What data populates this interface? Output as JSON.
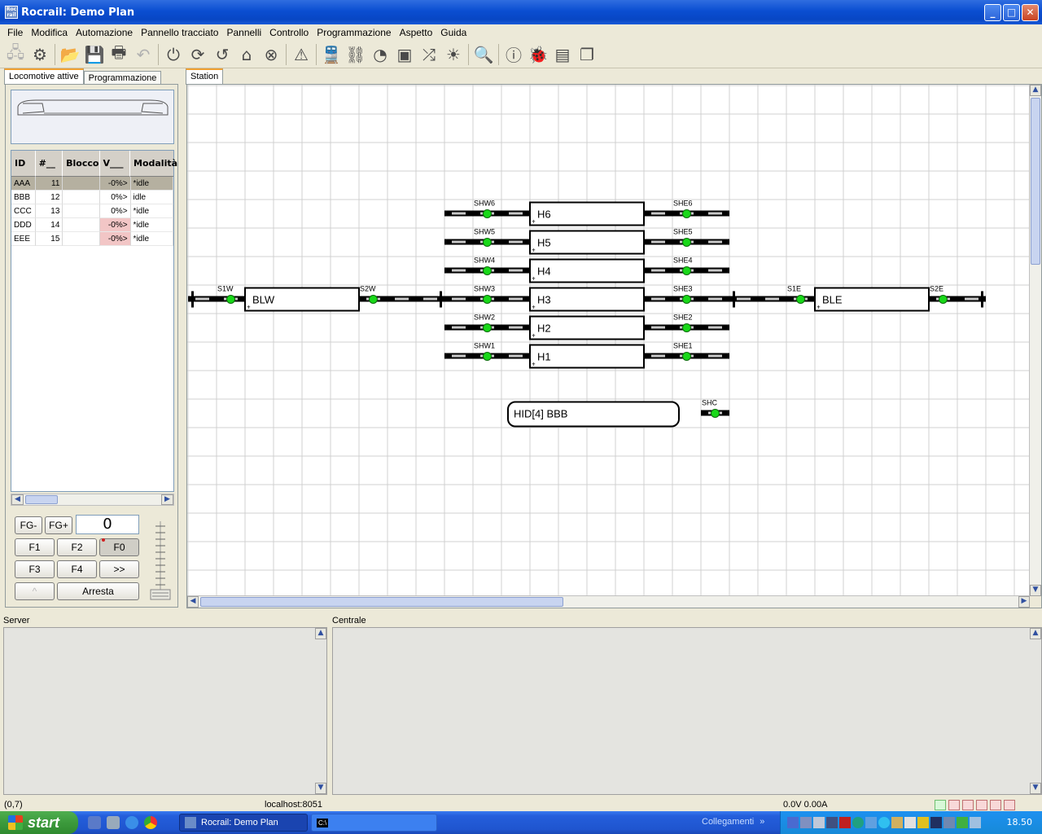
{
  "window": {
    "title": "Rocrail: Demo Plan",
    "app_icon_text": "Roc rail",
    "minimize": "_",
    "maximize": "□",
    "close": "✕"
  },
  "menu": [
    "File",
    "Modifica",
    "Automazione",
    "Pannello tracciato",
    "Pannelli",
    "Controllo",
    "Programmazione",
    "Aspetto",
    "Guida"
  ],
  "left_tabs": {
    "active": "Locomotive attive",
    "other": "Programmazione"
  },
  "loco_table": {
    "headers": [
      "ID",
      "#__",
      "Blocco",
      "V___",
      "Modalità"
    ],
    "rows": [
      {
        "id": "AAA",
        "num": "11",
        "block": "",
        "v": "-0%>",
        "mode": "*idle",
        "selected": true
      },
      {
        "id": "BBB",
        "num": "12",
        "block": "",
        "v": "0%>",
        "mode": "idle"
      },
      {
        "id": "CCC",
        "num": "13",
        "block": "",
        "v": "0%>",
        "mode": "*idle"
      },
      {
        "id": "DDD",
        "num": "14",
        "block": "",
        "v": "-0%>",
        "mode": "*idle",
        "pink": true
      },
      {
        "id": "EEE",
        "num": "15",
        "block": "",
        "v": "-0%>",
        "mode": "*idle",
        "pink": true
      }
    ]
  },
  "throttle": {
    "fg_minus": "FG-",
    "fg_plus": "FG+",
    "speed": "0",
    "f1": "F1",
    "f2": "F2",
    "f0": "F0",
    "f3": "F3",
    "f4": "F4",
    "more": ">>",
    "dir": "^",
    "stop": "Arresta"
  },
  "plan_tab": "Station",
  "plan": {
    "blocks": [
      "H6",
      "H5",
      "H4",
      "H3",
      "H2",
      "H1",
      "BLW",
      "BLE"
    ],
    "signals_west": [
      "SHW6",
      "SHW5",
      "SHW4",
      "SHW3",
      "SHW2",
      "SHW1"
    ],
    "signals_east": [
      "SHE6",
      "SHE5",
      "SHE4",
      "SHE3",
      "SHE2",
      "SHE1"
    ],
    "other_signals": [
      "S1W",
      "S2W",
      "S1E",
      "S2E",
      "SHC"
    ],
    "text_block": "HID[4] BBB",
    "colors": {
      "signal_green": "#19d819",
      "track": "#000000",
      "grid": "#d0d0d0"
    }
  },
  "panels": {
    "server": "Server",
    "central": "Centrale"
  },
  "status": {
    "coords": "(0,7)",
    "host": "localhost:8051",
    "power": "0.0V 0.00A"
  },
  "taskbar": {
    "start": "start",
    "task_rocrail": "Rocrail: Demo Plan",
    "task_console": "C:\\",
    "links": "Collegamenti",
    "links_arrow": "»",
    "time": "18.50"
  }
}
